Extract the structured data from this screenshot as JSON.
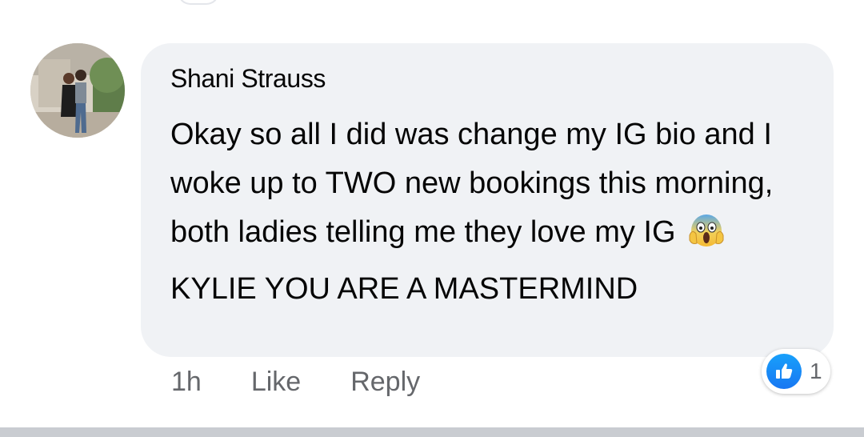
{
  "comment": {
    "author": "Shani Strauss",
    "text_part1": "Okay so all I did was change my IG bio and I woke up to TWO new bookings this morning, both ladies telling me they love my IG",
    "emoji": "face-screaming-in-fear-emoji",
    "text_part2": "KYLIE YOU ARE A MASTERMIND",
    "timestamp": "1h",
    "like_label": "Like",
    "reply_label": "Reply",
    "reaction_icon": "thumbs-up-icon",
    "reaction_count": "1"
  },
  "colors": {
    "bubble_bg": "#f0f2f5",
    "meta_text": "#65676b",
    "like_blue": "#1877f2"
  }
}
